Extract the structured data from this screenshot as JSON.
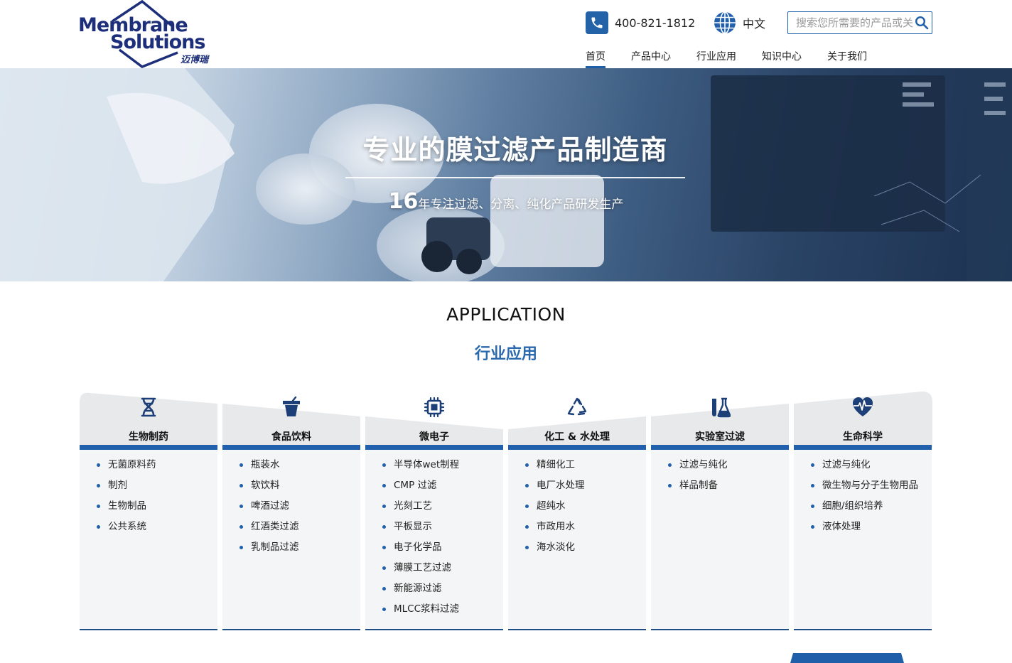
{
  "header": {
    "logo": {
      "line1": "Membrane",
      "line2": "Solutions",
      "cn": "迈博瑞"
    },
    "phone": "400-821-1812",
    "lang": "中文",
    "search_placeholder": "搜索您所需要的产品或关键词",
    "nav": [
      {
        "label": "首页",
        "active": true
      },
      {
        "label": "产品中心",
        "active": false
      },
      {
        "label": "行业应用",
        "active": false
      },
      {
        "label": "知识中心",
        "active": false
      },
      {
        "label": "关于我们",
        "active": false
      }
    ]
  },
  "banner": {
    "title": "专业的膜过滤产品制造商",
    "sub_num": "16",
    "sub_text": "年专注过滤、分离、纯化产品研发生产"
  },
  "application": {
    "title_en": "APPLICATION",
    "title_cn": "行业应用",
    "cards": [
      {
        "title": "生物制药",
        "icon": "dna-icon",
        "items": [
          "无菌原料药",
          "制剂",
          "生物制品",
          "公共系统"
        ]
      },
      {
        "title": "食品饮料",
        "icon": "cup-icon",
        "items": [
          "瓶装水",
          "软饮料",
          "啤酒过滤",
          "红酒类过滤",
          "乳制品过滤"
        ]
      },
      {
        "title": "微电子",
        "icon": "chip-icon",
        "items": [
          "半导体wet制程",
          "CMP 过滤",
          "光刻工艺",
          "平板显示",
          "电子化学品",
          "薄膜工艺过滤",
          "新能源过滤",
          "MLCC浆料过滤"
        ]
      },
      {
        "title": "化工 & 水处理",
        "icon": "recycle-icon",
        "items": [
          "精细化工",
          "电厂水处理",
          "超纯水",
          "市政用水",
          "海水淡化"
        ]
      },
      {
        "title": "实验室过滤",
        "icon": "lab-flask-icon",
        "items": [
          "过滤与纯化",
          "样品制备"
        ]
      },
      {
        "title": "生命科学",
        "icon": "heart-pulse-icon",
        "items": [
          "过滤与纯化",
          "微生物与分子生物用品",
          "细胞/组织培养",
          "液体处理"
        ]
      }
    ]
  },
  "colors": {
    "brand_navy": "#1d2f7a",
    "accent_blue": "#2160ac",
    "card_bg": "#f4f5f6"
  }
}
